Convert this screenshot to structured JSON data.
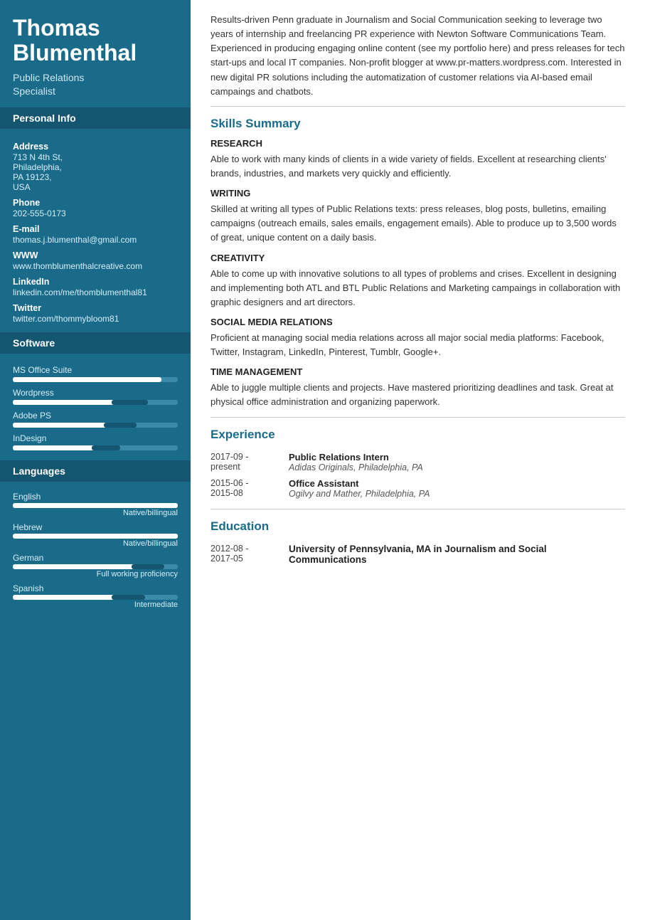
{
  "sidebar": {
    "name_line1": "Thomas",
    "name_line2": "Blumenthal",
    "title": "Public Relations\nSpecialist",
    "personal_info_label": "Personal Info",
    "fields": [
      {
        "label": "Address",
        "value": "713 N 4th St,\nPhiladelphia,\nPA 19123,\nUSA"
      },
      {
        "label": "Phone",
        "value": "202-555-0173"
      },
      {
        "label": "E-mail",
        "value": "thomas.j.blumenthal@gmail.com"
      },
      {
        "label": "WWW",
        "value": "www.thomblumenthalcreative.com"
      },
      {
        "label": "LinkedIn",
        "value": "linkedin.com/me/thomblumenthal81"
      },
      {
        "label": "Twitter",
        "value": "twitter.com/thommybloom81"
      }
    ],
    "software_label": "Software",
    "software": [
      {
        "name": "MS Office Suite",
        "fill_pct": 90,
        "dark_start": null,
        "dark_pct": null
      },
      {
        "name": "Wordpress",
        "fill_pct": 58,
        "dark_start": 58,
        "dark_pct": 22
      },
      {
        "name": "Adobe PS",
        "fill_pct": 55,
        "dark_start": 55,
        "dark_pct": 18
      },
      {
        "name": "InDesign",
        "fill_pct": 50,
        "dark_start": 50,
        "dark_pct": 15
      }
    ],
    "languages_label": "Languages",
    "languages": [
      {
        "name": "English",
        "fill_pct": 100,
        "dark_pct": 0,
        "proficiency": "Native/billingual"
      },
      {
        "name": "Hebrew",
        "fill_pct": 100,
        "dark_pct": 0,
        "proficiency": "Native/billingual"
      },
      {
        "name": "German",
        "fill_pct": 72,
        "dark_pct": 18,
        "proficiency": "Full working proficiency"
      },
      {
        "name": "Spanish",
        "fill_pct": 60,
        "dark_pct": 18,
        "proficiency": "Intermediate"
      }
    ]
  },
  "main": {
    "summary": "Results-driven Penn graduate in Journalism and Social Communication seeking to leverage two years of internship and freelancing PR experience with Newton Software Communications Team. Experienced in producing engaging online content (see my portfolio here) and press releases for tech start-ups and local IT companies. Non-profit blogger at www.pr-matters.wordpress.com. Interested in new digital PR solutions including the automatization of customer relations via AI-based email campaings and chatbots.",
    "skills_section": {
      "title": "Skills Summary",
      "skills": [
        {
          "name": "RESEARCH",
          "desc": "Able to work with many kinds of clients in a wide variety of fields. Excellent at researching clients' brands, industries, and markets very quickly and efficiently."
        },
        {
          "name": "WRITING",
          "desc": "Skilled at writing all types of Public Relations texts: press releases, blog posts, bulletins, emailing campaigns (outreach emails, sales emails, engagement emails). Able to produce up to 3,500 words of great, unique content on a daily basis."
        },
        {
          "name": "CREATIVITY",
          "desc": "Able to come up with innovative solutions to all types of problems and crises. Excellent in designing and implementing both ATL and BTL Public Relations and Marketing campaings in collaboration with graphic designers and art directors."
        },
        {
          "name": "SOCIAL MEDIA RELATIONS",
          "desc": "Proficient at managing social media relations across all major social media platforms: Facebook, Twitter, Instagram, LinkedIn, Pinterest, Tumblr, Google+."
        },
        {
          "name": "TIME MANAGEMENT",
          "desc": "Able to juggle multiple clients and projects. Have mastered prioritizing deadlines and task. Great at physical office administration and organizing paperwork."
        }
      ]
    },
    "experience_section": {
      "title": "Experience",
      "items": [
        {
          "date": "2017-09 -\npresent",
          "role": "Public Relations Intern",
          "org": "Adidas Originals, Philadelphia, PA"
        },
        {
          "date": "2015-06 -\n2015-08",
          "role": "Office Assistant",
          "org": "Ogilvy and Mather, Philadelphia, PA"
        }
      ]
    },
    "education_section": {
      "title": "Education",
      "items": [
        {
          "date": "2012-08 -\n2017-05",
          "degree": "University of Pennsylvania, MA in Journalism and Social Communications"
        }
      ]
    }
  }
}
